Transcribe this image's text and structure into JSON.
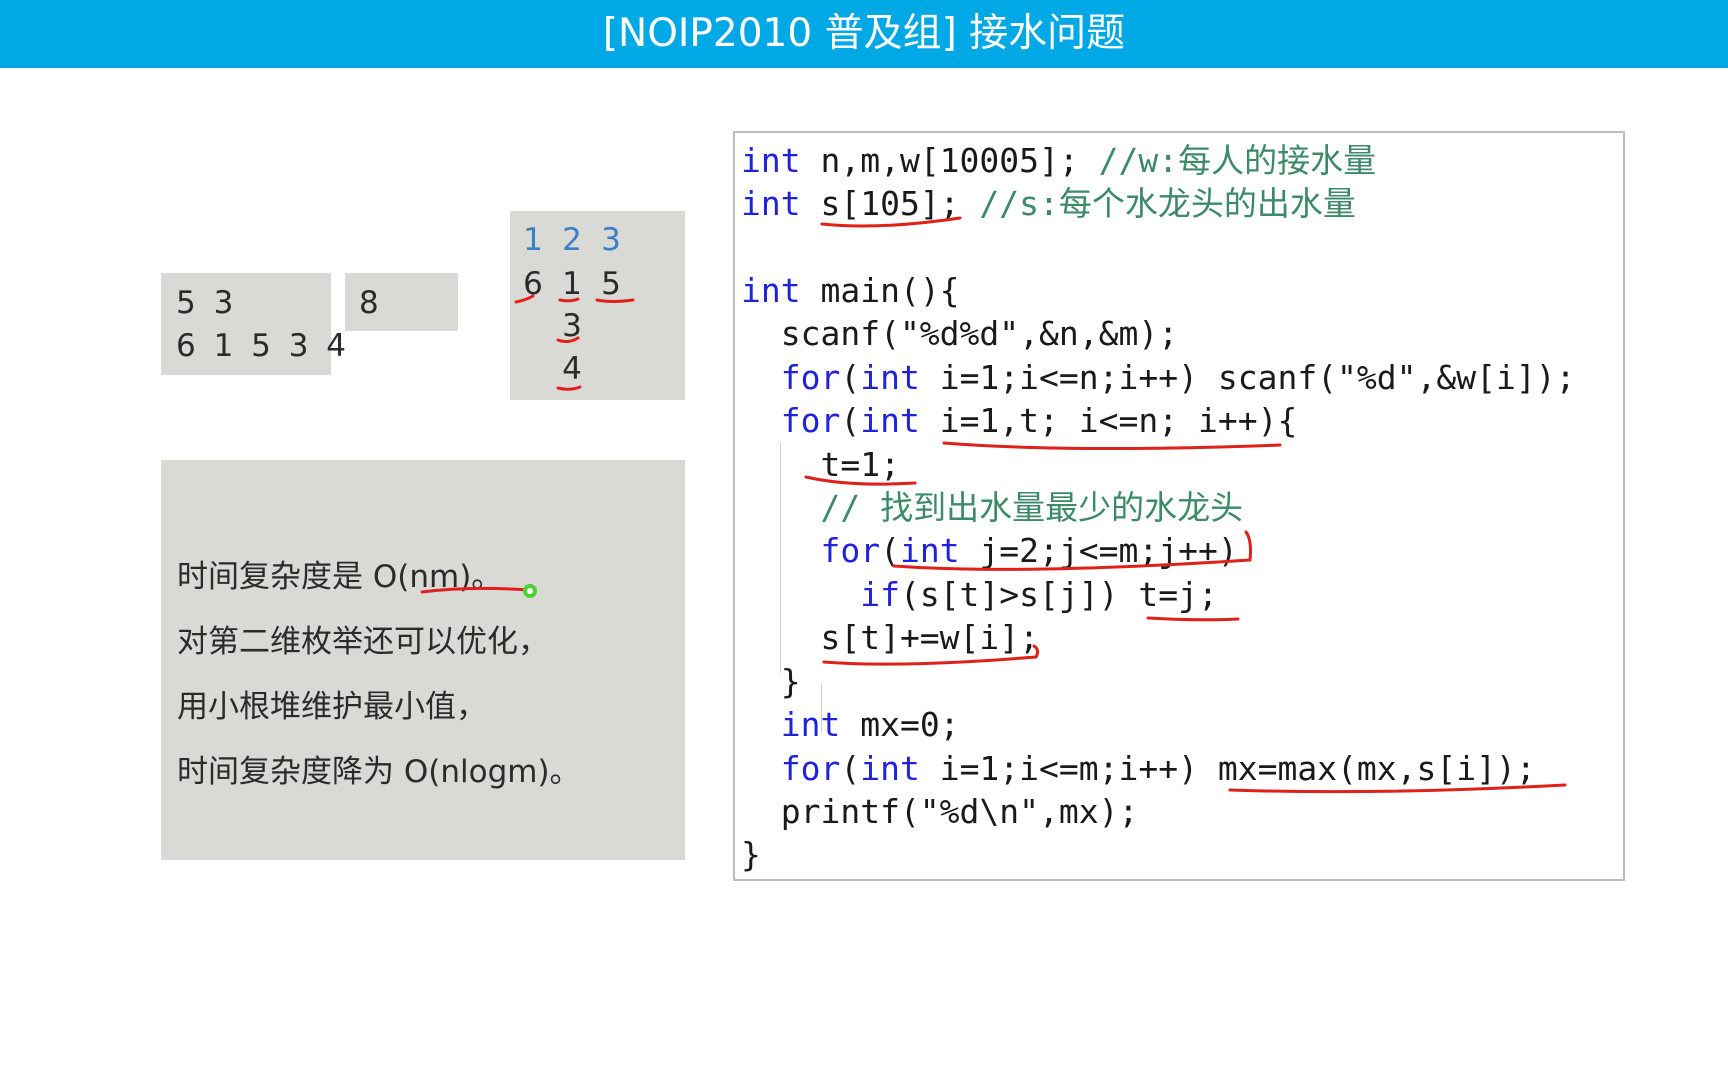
{
  "header": {
    "title": "[NOIP2010 普及组] 接水问题"
  },
  "sample": {
    "input_line1": "5 3",
    "input_line2": "6 1 5 3 4",
    "output": "8"
  },
  "simulation": {
    "headers": [
      "1",
      "2",
      "3"
    ],
    "row1": [
      "6",
      "1",
      "5"
    ],
    "col2_extra": [
      "3",
      "4"
    ]
  },
  "note": {
    "line1": "时间复杂度是 O(nm)。",
    "line2": "对第二维枚举还可以优化，",
    "line3": "用小根堆维护最小值，",
    "line4": "时间复杂度降为 O(nlogm)。"
  },
  "code": {
    "l1_kw": "int",
    "l1_code": " n,m,w[10005]; ",
    "l1_cm": "//w:每人的接水量",
    "l2_kw": "int",
    "l2_code": " s[105]; ",
    "l2_cm": "//s:每个水龙头的出水量",
    "l4_kw": "int",
    "l4_code": " main(){",
    "l5": "  scanf(\"%d%d\",&n,&m);",
    "l6_for": "  for",
    "l6_a": "(",
    "l6_int": "int",
    "l6_b": " i=1;i<=n;i++) scanf(\"%d\",&w[i]);",
    "l7_for": "  for",
    "l7_a": "(",
    "l7_int": "int",
    "l7_b": " i=1,t; i<=n; i++){",
    "l8": "    t=1;",
    "l9_cm": "    // 找到出水量最少的水龙头",
    "l10_for": "    for",
    "l10_a": "(",
    "l10_int": "int",
    "l10_b": " j=2;j<=m;j++)",
    "l11_if": "      if",
    "l11_b": "(s[t]>s[j]) t=j;",
    "l12": "    s[t]+=w[i];",
    "l13": "  }",
    "l14_kw": "  int",
    "l14_b": " mx=0;",
    "l15_for": "  for",
    "l15_a": "(",
    "l15_int": "int",
    "l15_b": " i=1;i<=m;i++) mx=max(mx,s[i]);",
    "l16": "  printf(\"%d\\n\",mx);",
    "l17": "}"
  },
  "colors": {
    "header_bg": "#00a8e6",
    "panel_gray": "#d9d9d6",
    "annotation_red": "#e0201a",
    "cursor_green": "#4cd137"
  }
}
